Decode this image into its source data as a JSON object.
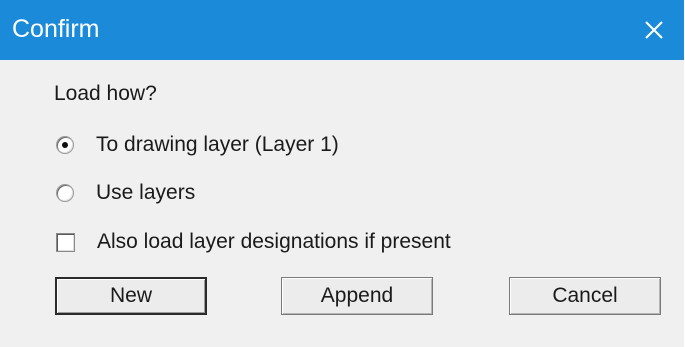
{
  "window": {
    "title": "Confirm",
    "close_glyph": "✕",
    "colors": {
      "titlebar": "#1b8bd9",
      "client": "#f0f0f0"
    }
  },
  "dialog": {
    "prompt": "Load how?",
    "options": [
      {
        "label": "To drawing layer (Layer 1)",
        "selected": true
      },
      {
        "label": "Use layers",
        "selected": false
      }
    ],
    "checkbox": {
      "label": "Also load layer designations if present",
      "checked": false
    }
  },
  "buttons": {
    "new_label": "New",
    "append_label": "Append",
    "cancel_label": "Cancel"
  }
}
